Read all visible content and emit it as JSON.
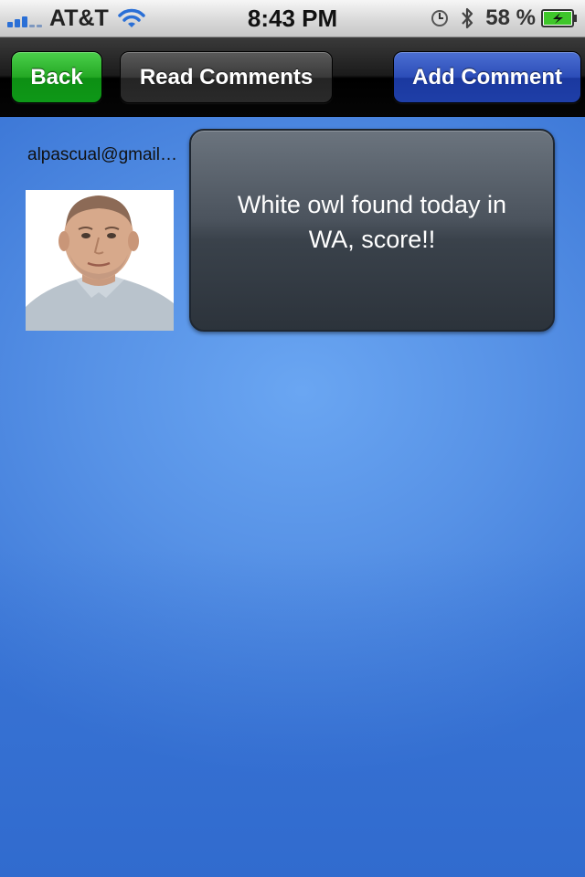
{
  "status_bar": {
    "carrier": "AT&T",
    "time": "8:43 PM",
    "battery_percent": "58 %",
    "signal_bars": 3,
    "signal_total": 5,
    "icons": [
      "signal-icon",
      "wifi-icon",
      "clock-icon",
      "bluetooth-icon",
      "battery-icon"
    ]
  },
  "toolbar": {
    "back_label": "Back",
    "read_comments_label": "Read Comments",
    "add_comment_label": "Add Comment"
  },
  "post": {
    "author": "alpascual@gmail…",
    "message": "White owl found today in WA, score!!"
  },
  "colors": {
    "back_button": "#24a824",
    "read_button": "#3a3a3a",
    "add_button": "#2c4db8",
    "background": "#5792e6",
    "bubble": "#4b535d"
  }
}
